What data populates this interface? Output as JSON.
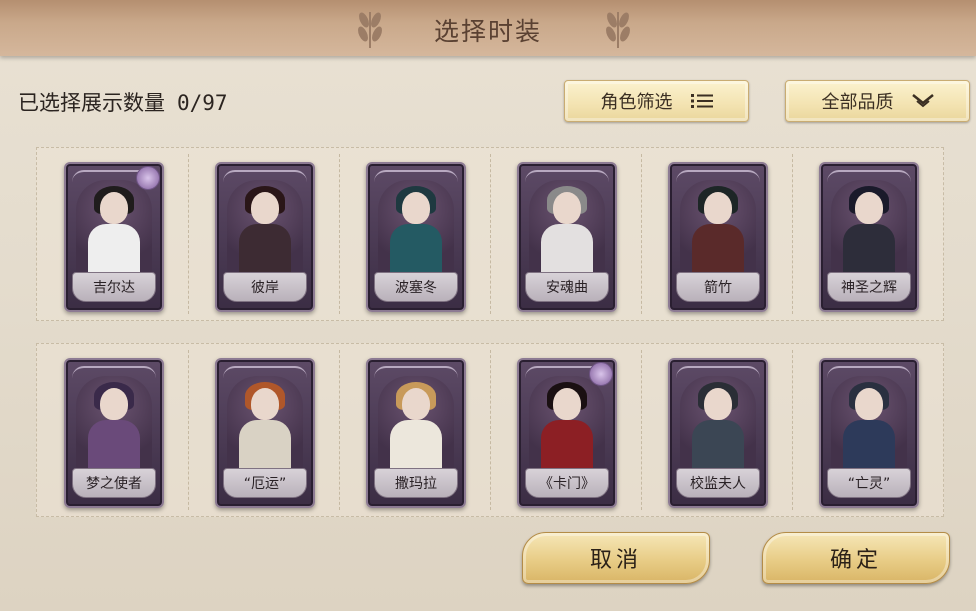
{
  "header": {
    "title": "选择时装"
  },
  "selection": {
    "label": "已选择展示数量",
    "value": "0/97"
  },
  "filters": {
    "role_label": "角色筛选",
    "quality_label": "全部品质"
  },
  "costumes_row1": [
    {
      "name": "吉尔达",
      "hair": "#1f1c1c",
      "body": "#eeeeee",
      "badge": true
    },
    {
      "name": "彼岸",
      "hair": "#2a1618",
      "body": "#3d2b33",
      "badge": false
    },
    {
      "name": "波塞冬",
      "hair": "#1e3940",
      "body": "#245a63",
      "badge": false
    },
    {
      "name": "安魂曲",
      "hair": "#8a8a8a",
      "body": "#e3e0e0",
      "badge": false
    },
    {
      "name": "箭竹",
      "hair": "#1d2626",
      "body": "#5a2a2a",
      "badge": false
    },
    {
      "name": "神圣之辉",
      "hair": "#1a1a2a",
      "body": "#2d2d3a",
      "badge": false
    }
  ],
  "costumes_row2": [
    {
      "name": "梦之使者",
      "hair": "#3a2a4a",
      "body": "#6a4a7a",
      "badge": false
    },
    {
      "name": "“厄运”",
      "hair": "#b0572a",
      "body": "#d9d2c4",
      "badge": false
    },
    {
      "name": "撒玛拉",
      "hair": "#c89a5a",
      "body": "#ece7dc",
      "badge": false
    },
    {
      "name": "《卡门》",
      "hair": "#1a1012",
      "body": "#8c1f24",
      "badge": true
    },
    {
      "name": "校监夫人",
      "hair": "#2a2e36",
      "body": "#3b4654",
      "badge": false
    },
    {
      "name": "“亡灵”",
      "hair": "#2a3040",
      "body": "#2d3a5a",
      "badge": false
    }
  ],
  "actions": {
    "cancel_label": "取消",
    "confirm_label": "确定"
  },
  "colors": {
    "card_bg": "#4a3a55",
    "button_gold": "#e8cc86",
    "title_bar": "#c9a88a"
  }
}
